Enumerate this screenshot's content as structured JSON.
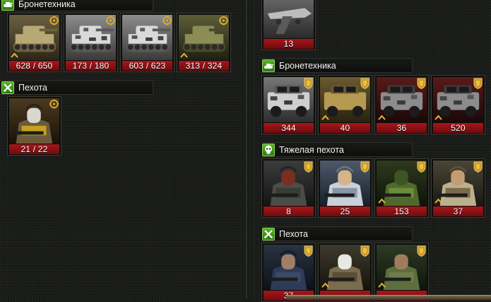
{
  "left": {
    "sections": [
      {
        "title": "Бронетехника",
        "icon": "tank-icon",
        "units": [
          {
            "count": "628 / 650",
            "art": "desert-artillery",
            "badge": "rank-gear-icon",
            "chevron": true
          },
          {
            "count": "173 / 180",
            "art": "urban-tank",
            "badge": "rank-gear-icon",
            "chevron": false
          },
          {
            "count": "603 / 623",
            "art": "urban-tank",
            "badge": "rank-gear-icon",
            "chevron": false
          },
          {
            "count": "313 / 324",
            "art": "green-tank",
            "badge": "rank-gear-icon",
            "chevron": true
          }
        ]
      },
      {
        "title": "Пехота",
        "icon": "crossed-swords-icon",
        "units": [
          {
            "count": "21 / 22",
            "art": "skull-soldier",
            "badge": "rank-gear-icon",
            "chevron": false
          }
        ]
      }
    ]
  },
  "right": {
    "top_unit": {
      "count": "13",
      "art": "attack-jet"
    },
    "sections": [
      {
        "title": "Бронетехника",
        "icon": "tank-icon",
        "units": [
          {
            "count": "344",
            "art": "urban-humvee",
            "badge": "rank-shield-icon",
            "chevron": false
          },
          {
            "count": "40",
            "art": "desert-humvee",
            "badge": "rank-shield-icon",
            "chevron": true
          },
          {
            "count": "36",
            "art": "armored-car",
            "badge": "rank-shield-icon",
            "chevron": true
          },
          {
            "count": "520",
            "art": "armored-car",
            "badge": "rank-shield-icon",
            "chevron": true
          }
        ]
      },
      {
        "title": "Тяжелая пехота",
        "icon": "skull-icon",
        "units": [
          {
            "count": "8",
            "art": "heavy-soldier-red",
            "badge": "rank-shield-icon",
            "chevron": false
          },
          {
            "count": "25",
            "art": "heavy-soldier-white",
            "badge": "rank-shield-icon",
            "chevron": false
          },
          {
            "count": "153",
            "art": "ghillie-soldier",
            "badge": "rank-shield-icon",
            "chevron": true
          },
          {
            "count": "37",
            "art": "desert-soldier",
            "badge": "rank-shield-icon",
            "chevron": true
          }
        ]
      },
      {
        "title": "Пехота",
        "icon": "crossed-swords-icon",
        "units": [
          {
            "count": "37",
            "art": "blue-soldier",
            "badge": "rank-shield-icon",
            "chevron": false
          },
          {
            "count": "",
            "art": "tan-soldier",
            "badge": "rank-shield-icon",
            "chevron": true
          },
          {
            "count": "",
            "art": "camo-soldier",
            "badge": "rank-shield-icon",
            "chevron": true
          }
        ]
      }
    ]
  },
  "colors": {
    "count_bar": "#a8161a",
    "header_icon": "#5ab02a",
    "badge_gold": "#e0a92a"
  }
}
